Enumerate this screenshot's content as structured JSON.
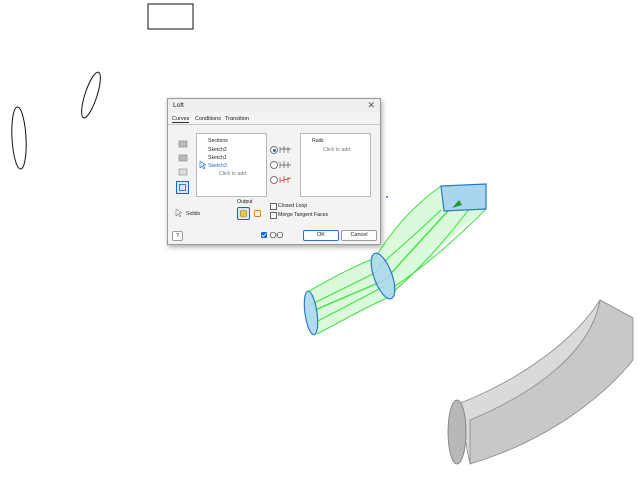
{
  "dialog": {
    "title": "Loft",
    "close_glyph": "✕",
    "tabs": [
      "Curves",
      "Conditions",
      "Transition"
    ],
    "sections": {
      "header": "Sections",
      "items": [
        "Sketch2",
        "Sketch1",
        "Sketch3"
      ],
      "selected_index": 2,
      "placeholder": "Click to add"
    },
    "rails": {
      "header": "Rails",
      "placeholder": "Click to add"
    },
    "solids_label": "Solids",
    "output_label": "Output",
    "closed_loop_label": "Closed Loop",
    "merge_tangent_label": "Merge Tangent Faces",
    "ok_label": "OK",
    "cancel_label": "Cancel",
    "help_glyph": "?",
    "icons": [
      "add-section-icon",
      "sweep-section-icon",
      "rail-section-icon",
      "centerline-icon",
      "rail-mode-icon",
      "centerline-mode-icon",
      "area-loft-icon",
      "select-arrow-icon",
      "solid-output-icon",
      "surface-output-icon",
      "preview-glasses-icon",
      "help-icon"
    ]
  },
  "colors": {
    "accent": "#1a63d1",
    "loft_preview": "#3ae33a",
    "section_fill": "#a9d6ee",
    "section_stroke": "#2a78c8",
    "solid_body": "#dadada"
  }
}
